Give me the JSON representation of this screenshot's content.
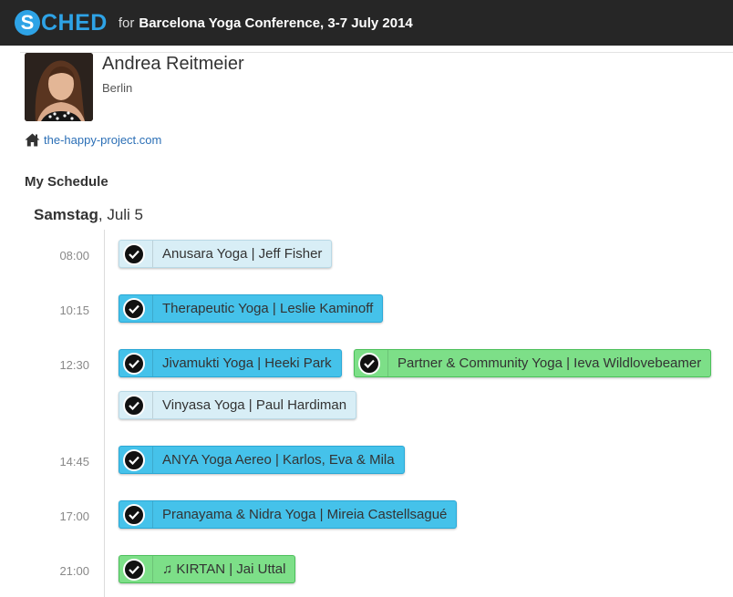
{
  "header": {
    "logo_s": "S",
    "logo_rest": "CHED",
    "for_text": "for",
    "conference": "Barcelona Yoga Conference, 3-7 July 2014"
  },
  "profile": {
    "name": "Andrea Reitmeier",
    "city": "Berlin",
    "website": "the-happy-project.com"
  },
  "schedule": {
    "heading": "My Schedule",
    "day_name": "Samstag",
    "day_rest": ", Juli 5",
    "times": [
      "08:00",
      "10:15",
      "12:30",
      "14:45",
      "17:00",
      "21:00"
    ],
    "sessions": [
      {
        "title": "Anusara Yoga | Jeff Fisher",
        "color": "#d8eef6"
      },
      {
        "title": "Therapeutic Yoga | Leslie Kaminoff",
        "color": "#45c2ea"
      },
      {
        "title": "Jivamukti Yoga | Heeki Park",
        "color": "#45c2ea"
      },
      {
        "title": "Partner & Community Yoga | Ieva Wildlovebeamer",
        "color": "#7ddf88"
      },
      {
        "title": "Vinyasa Yoga | Paul Hardiman",
        "color": "#d8eef6"
      },
      {
        "title": "ANYA Yoga Aereo | Karlos, Eva & Mila",
        "color": "#45c2ea"
      },
      {
        "title": "Pranayama & Nidra Yoga | Mireia Castellsagué",
        "color": "#45c2ea"
      },
      {
        "title": "♫ KIRTAN | Jai Uttal",
        "color": "#7ddf88"
      }
    ]
  },
  "colors": {
    "brand": "#2ea3e6",
    "topbar": "#262626",
    "link": "#2b6fb6"
  }
}
